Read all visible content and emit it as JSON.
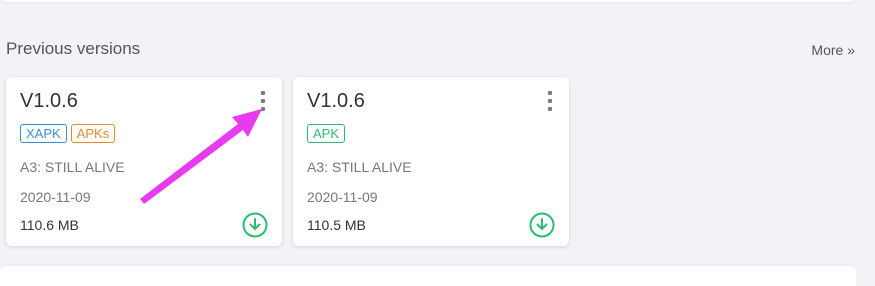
{
  "section": {
    "title": "Previous versions",
    "more_label": "More »"
  },
  "cards": [
    {
      "version": "V1.0.6",
      "tags": [
        {
          "label": "XAPK",
          "color": "#3a8fd8"
        },
        {
          "label": "APKs",
          "color": "#e28a2d"
        }
      ],
      "name": "A3: STILL ALIVE",
      "date": "2020-11-09",
      "size": "110.6 MB"
    },
    {
      "version": "V1.0.6",
      "tags": [
        {
          "label": "APK",
          "color": "#2dbb72"
        }
      ],
      "name": "A3: STILL ALIVE",
      "date": "2020-11-09",
      "size": "110.5 MB"
    }
  ],
  "colors": {
    "download_icon": "#2dbb72",
    "annotation_arrow": "#e83bf0"
  }
}
